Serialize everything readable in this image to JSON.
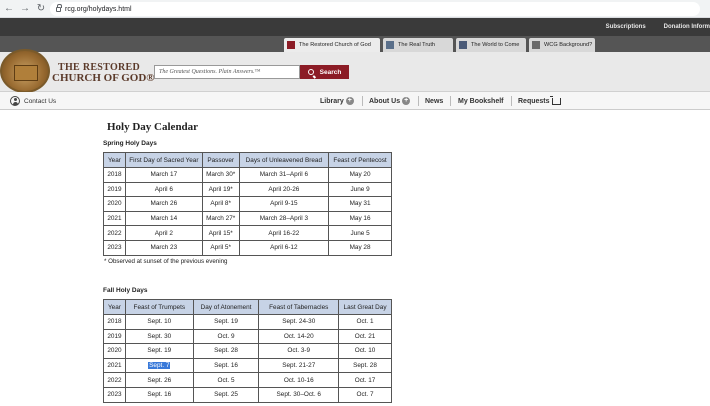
{
  "browser": {
    "url": "rcg.org/holydays.html"
  },
  "topbar": {
    "links": [
      "Subscriptions",
      "Donation Inform"
    ]
  },
  "site_tabs": [
    {
      "label": "The Restored Church of God",
      "color": "#8c1c26"
    },
    {
      "label": "The Real Truth",
      "color": "#5a6f8a"
    },
    {
      "label": "The World to Come",
      "color": "#4a5a78"
    },
    {
      "label": "WCG Background?",
      "color": "#6a6a6a"
    }
  ],
  "header": {
    "logo_line1": "THE RESTORED",
    "logo_line2": "CHURCH OF GOD®",
    "search_placeholder": "The Greatest Questions. Plain Answers.™",
    "search_button": "Search"
  },
  "nav": {
    "contact": "Contact Us",
    "items": [
      "Library",
      "About Us",
      "News",
      "My Bookshelf",
      "Requests"
    ]
  },
  "content": {
    "title": "Holy Day Calendar",
    "spring": {
      "heading": "Spring Holy Days",
      "columns": [
        "Year",
        "First Day of Sacred Year",
        "Passover",
        "Days of Unleavened Bread",
        "Feast of Pentecost"
      ],
      "rows": [
        [
          "2018",
          "March 17",
          "March 30*",
          "March 31–April 6",
          "May 20"
        ],
        [
          "2019",
          "April 6",
          "April 19*",
          "April 20-26",
          "June 9"
        ],
        [
          "2020",
          "March 26",
          "April 8*",
          "April 9-15",
          "May 31"
        ],
        [
          "2021",
          "March 14",
          "March 27*",
          "March 28–April 3",
          "May 16"
        ],
        [
          "2022",
          "April 2",
          "April 15*",
          "April 16-22",
          "June 5"
        ],
        [
          "2023",
          "March 23",
          "April 5*",
          "April 6-12",
          "May 28"
        ]
      ],
      "note": "* Observed at sunset of the previous evening"
    },
    "fall": {
      "heading": "Fall Holy Days",
      "columns": [
        "Year",
        "Feast of Trumpets",
        "Day of Atonement",
        "Feast of Tabernacles",
        "Last Great Day"
      ],
      "rows": [
        [
          "2018",
          "Sept. 10",
          "Sept. 19",
          "Sept. 24-30",
          "Oct. 1"
        ],
        [
          "2019",
          "Sept. 30",
          "Oct. 9",
          "Oct. 14-20",
          "Oct. 21"
        ],
        [
          "2020",
          "Sept. 19",
          "Sept. 28",
          "Oct. 3-9",
          "Oct. 10"
        ],
        [
          "2021",
          "Sept. 7",
          "Sept. 16",
          "Sept. 21-27",
          "Sept. 28"
        ],
        [
          "2022",
          "Sept. 26",
          "Oct. 5",
          "Oct. 10-16",
          "Oct. 17"
        ],
        [
          "2023",
          "Sept. 16",
          "Sept. 25",
          "Sept. 30–Oct. 6",
          "Oct. 7"
        ]
      ],
      "selected_cell": "Sept. 7"
    }
  }
}
